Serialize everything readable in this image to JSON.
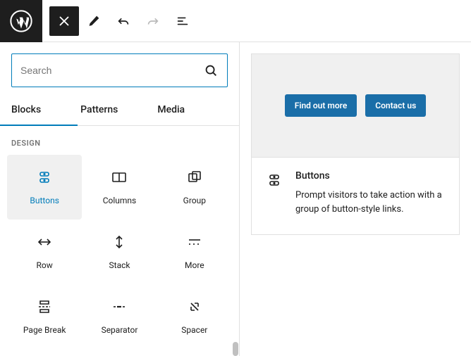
{
  "search": {
    "placeholder": "Search"
  },
  "tabs": {
    "blocks": "Blocks",
    "patterns": "Patterns",
    "media": "Media"
  },
  "section_label": "DESIGN",
  "blocks": {
    "buttons": "Buttons",
    "columns": "Columns",
    "group": "Group",
    "row": "Row",
    "stack": "Stack",
    "more": "More",
    "page_break": "Page Break",
    "separator": "Separator",
    "spacer": "Spacer"
  },
  "preview": {
    "btn1": "Find out more",
    "btn2": "Contact us",
    "title": "Buttons",
    "description": "Prompt visitors to take action with a group of button-style links."
  },
  "colors": {
    "accent": "#007cba",
    "demo_btn": "#1a6ea8"
  }
}
